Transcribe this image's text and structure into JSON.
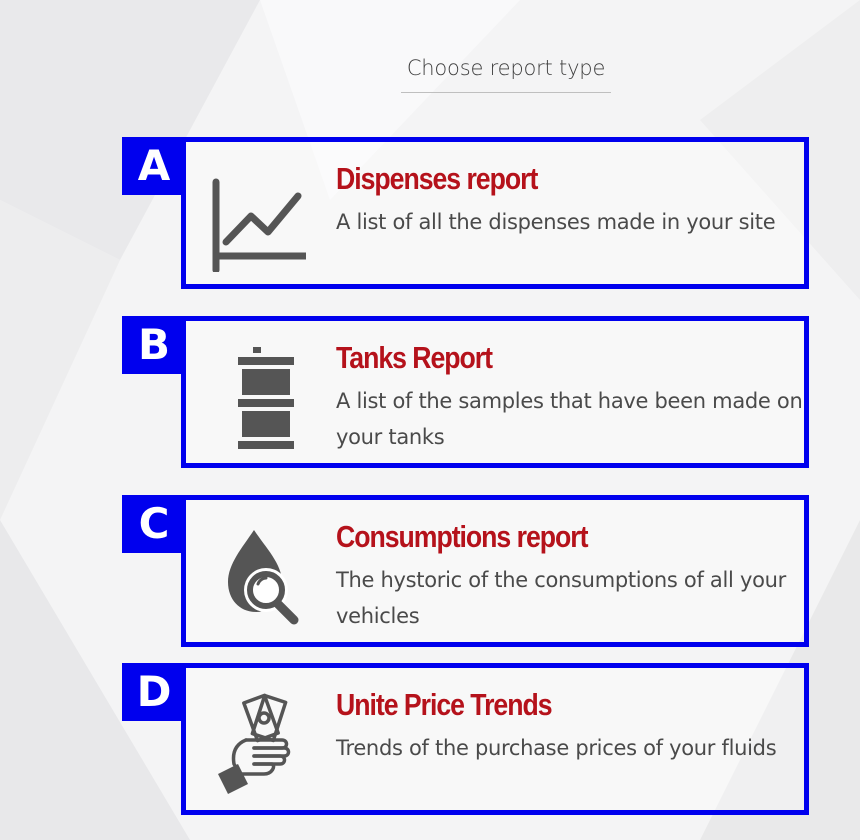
{
  "header": {
    "title": "Choose report type"
  },
  "reports": [
    {
      "letter": "A",
      "title": "Dispenses report",
      "description": "A list of all the dispenses made in your site",
      "icon": "line-chart-icon"
    },
    {
      "letter": "B",
      "title": "Tanks Report",
      "description": "A list of the samples that have been made on your tanks",
      "icon": "barrel-icon"
    },
    {
      "letter": "C",
      "title": "Consumptions report",
      "description": "The hystoric of the consumptions of all your vehicles",
      "icon": "drop-magnifier-icon"
    },
    {
      "letter": "D",
      "title": "Unite Price Trends",
      "description": "Trends of the purchase prices of your fluids",
      "icon": "hand-money-icon"
    }
  ],
  "colors": {
    "accent_blue": "#0000ee",
    "title_red": "#b5121b",
    "text_gray": "#4a4a4a",
    "icon_gray": "#555555"
  }
}
